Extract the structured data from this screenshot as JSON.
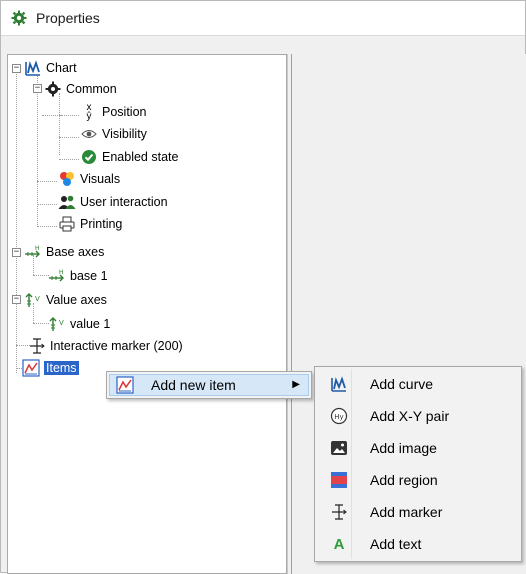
{
  "window": {
    "title": "Properties"
  },
  "tree": {
    "chart": "Chart",
    "common": "Common",
    "position": "Position",
    "visibility": "Visibility",
    "enabled_state": "Enabled state",
    "visuals": "Visuals",
    "user_interaction": "User interaction",
    "printing": "Printing",
    "base_axes": "Base axes",
    "base_1": "base 1",
    "value_axes": "Value axes",
    "value_1": "value 1",
    "interactive_marker": "Interactive marker (200)",
    "items": "Items",
    "expander_minus": "−"
  },
  "context_menu": {
    "add_new_item": "Add new item",
    "submenu_arrow": "▶"
  },
  "submenu": {
    "items": [
      {
        "label": "Add curve",
        "icon": "curve-icon"
      },
      {
        "label": "Add X-Y pair",
        "icon": "xy-pair-icon"
      },
      {
        "label": "Add image",
        "icon": "image-icon"
      },
      {
        "label": "Add region",
        "icon": "region-icon"
      },
      {
        "label": "Add marker",
        "icon": "marker-icon"
      },
      {
        "label": "Add text",
        "icon": "text-icon"
      }
    ]
  },
  "icon_glyphs": {
    "position_x": "x",
    "position_y": "ŷ",
    "text_A": "A",
    "xy": "Hy",
    "axis_h": "H",
    "axis_v": "V"
  },
  "colors": {
    "selection": "#2b65c9",
    "menu_highlight": "#d6e7f7",
    "curve_blue": "#1e5aa8",
    "enabled_green": "#2a8a3a",
    "text_A_green": "#2e9a3a"
  }
}
